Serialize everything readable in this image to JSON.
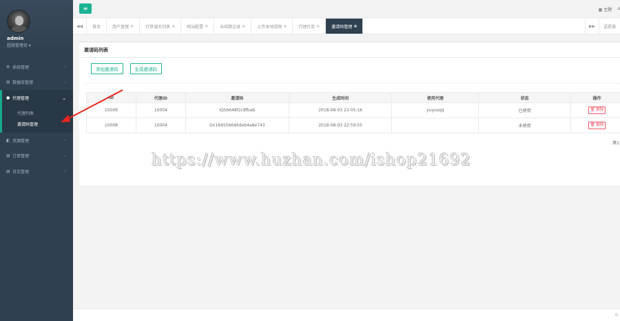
{
  "sidebar": {
    "username": "admin",
    "role": "超级管理员 ▾",
    "items": [
      {
        "label": "系统管理",
        "icon": "gear-icon",
        "glyph": "⚙"
      },
      {
        "label": "数据库管理",
        "icon": "database-icon",
        "glyph": "▤"
      },
      {
        "label": "代理管理",
        "icon": "users-icon",
        "glyph": "👥"
      },
      {
        "label": "资源管理",
        "icon": "folder-icon",
        "glyph": "◧"
      },
      {
        "label": "订单管理",
        "icon": "list-icon",
        "glyph": "▤"
      },
      {
        "label": "日志管理",
        "icon": "log-icon",
        "glyph": "▤"
      }
    ],
    "subitems": [
      {
        "label": "代理列表"
      },
      {
        "label": "邀请码管理"
      }
    ]
  },
  "topbar": {
    "menu_glyph": "≡",
    "theme_label": "主题",
    "home_glyph": "⌂"
  },
  "tabs": {
    "prev_glyph": "◀◀",
    "next_glyph": "▶▶",
    "items": [
      {
        "label": "首页"
      },
      {
        "label": "用户管理"
      },
      {
        "label": "打赏域名列表"
      },
      {
        "label": "网站配置"
      },
      {
        "label": "未结算记录"
      },
      {
        "label": "上传本地视频"
      },
      {
        "label": "代理片库"
      },
      {
        "label": "邀请码管理"
      }
    ],
    "close_ops": "语提操"
  },
  "panel": {
    "title": "邀请码列表",
    "add_button": "添加邀请码",
    "generate_button": "生成邀请码",
    "table": {
      "headers": [
        "ID",
        "代理ID",
        "邀请码",
        "生成时间",
        "使用代理",
        "状态",
        "操作"
      ],
      "rows": [
        {
          "id": "10009",
          "agent_id": "10004",
          "code": "lQ5b648f2c8fbab",
          "time": "2018-08-03 23:05:16",
          "used_by": "yuyusqq",
          "status": "已使用",
          "action": "🗑 删除"
        },
        {
          "id": "10008",
          "agent_id": "10004",
          "code": "Gn16455b646deb4a8e743",
          "time": "2018-08-03 22:59:55",
          "used_by": "",
          "status": "未使用",
          "action": "🗑 删除"
        }
      ]
    },
    "pager": "第1页"
  },
  "footer": {
    "text": "©"
  },
  "watermark": "https://www.huzhan.com/ishop21692",
  "colors": {
    "accent": "#1ab394",
    "sidebar": "#2f4050",
    "danger": "#ed5565",
    "arrow": "#e8231f"
  }
}
